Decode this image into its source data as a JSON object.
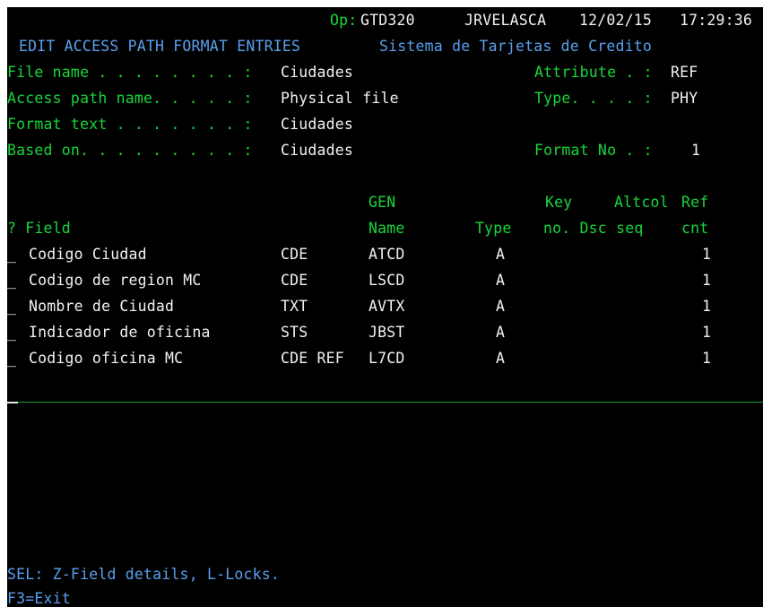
{
  "header": {
    "op_label": "Op:",
    "program": "GTD320",
    "user": "JRVELASCA",
    "date": "12/02/15",
    "time": "17:29:36",
    "screen_title": "EDIT ACCESS PATH FORMAT ENTRIES",
    "system_title": "Sistema de Tarjetas de Credito"
  },
  "info": {
    "file_name_label": "File name . . . . . . . . :",
    "file_name": "Ciudades",
    "access_path_label": "Access path name. . . . . :",
    "access_path": "Physical file",
    "format_text_label": "Format text . . . . . . . :",
    "format_text": "Ciudades",
    "based_on_label": "Based on. . . . . . . . . :",
    "based_on": "Ciudades",
    "attribute_label": "Attribute . :",
    "attribute": "REF",
    "type_label": "Type. . . . :",
    "type": "PHY",
    "format_no_label": "Format No . :",
    "format_no": "1"
  },
  "columns": {
    "gen": "GEN",
    "key": "Key",
    "altcol": "Altcol",
    "ref": "Ref",
    "select_field": "? Field",
    "name": "Name",
    "type": "Type",
    "no_dsc_seq": "no. Dsc seq",
    "cnt": "cnt"
  },
  "rows": [
    {
      "sel": "_",
      "field": "Codigo Ciudad",
      "usage": "CDE",
      "gen_name": "ATCD",
      "type": "A",
      "ref_cnt": "1"
    },
    {
      "sel": "_",
      "field": "Codigo de region MC",
      "usage": "CDE",
      "gen_name": "LSCD",
      "type": "A",
      "ref_cnt": "1"
    },
    {
      "sel": "_",
      "field": "Nombre de Ciudad",
      "usage": "TXT",
      "gen_name": "AVTX",
      "type": "A",
      "ref_cnt": "1"
    },
    {
      "sel": "_",
      "field": "Indicador de oficina",
      "usage": "STS",
      "gen_name": "JBST",
      "type": "A",
      "ref_cnt": "1"
    },
    {
      "sel": "_",
      "field": "Codigo oficina MC",
      "usage": "CDE REF",
      "gen_name": "L7CD",
      "type": "A",
      "ref_cnt": "1"
    }
  ],
  "footer": {
    "selection_help": "SEL: Z-Field details, L-Locks.",
    "function_keys": "F3=Exit"
  },
  "colors": {
    "background": "#000000",
    "green": "#19d63a",
    "white": "#f2f2f2",
    "blue": "#5aa0ee"
  }
}
